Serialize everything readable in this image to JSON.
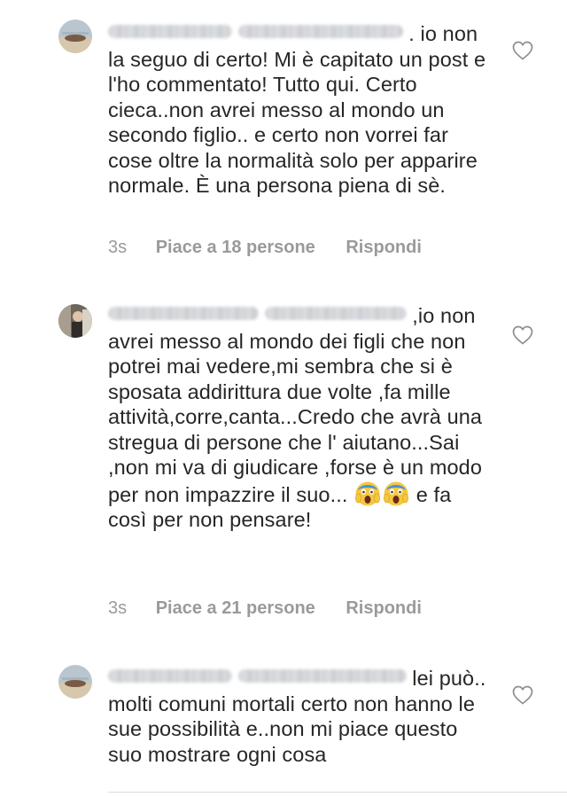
{
  "comments": [
    {
      "text": ". io non la seguo di certo! Mi è capitato un post e l'ho commentato! Tutto qui. Certo cieca..non avrei messo al mondo un secondo figlio.. e certo non vorrei far cose oltre la normalità solo per apparire normale. È una persona piena di sè.",
      "time": "3s",
      "likes": "Piace a 18 persone",
      "reply": "Rispondi"
    },
    {
      "text_before": ",io non avrei messo al mondo dei figli che non potrei mai vedere,mi sembra che si è sposata addirittura due volte ,fa mille attività,corre,canta...Credo che avrà una stregua di persone che l' aiutano...Sai ,non mi va di giudicare ,forse è un modo per non impazzire il suo...",
      "text_after": "e fa così per non pensare!",
      "emoji_icon": "screaming-face-emoji",
      "time": "3s",
      "likes": "Piace a 21 persone",
      "reply": "Rispondi"
    },
    {
      "text": "lei può.. molti comuni mortali certo non hanno le sue possibilità e..non mi piace questo suo mostrare ogni cosa"
    }
  ],
  "icons": {
    "like": "heart-outline-icon"
  },
  "colors": {
    "text": "#262626",
    "meta": "#9a9a9a",
    "heart": "#8e8e8e"
  }
}
